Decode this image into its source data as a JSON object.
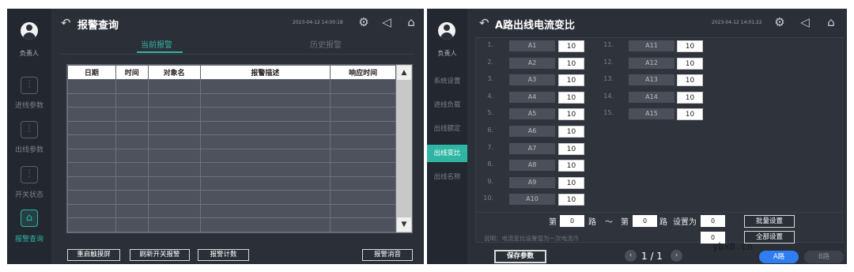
{
  "left": {
    "user_label": "负责人",
    "nav": [
      "进线参数",
      "出线参数",
      "开关状态",
      "报警查询"
    ],
    "title": "报警查询",
    "datetime": "2023-04-12 14:00:18",
    "tabs": [
      "当前报警",
      "历史报警"
    ],
    "table_headers": [
      "日期",
      "时间",
      "对象名",
      "报警描述",
      "响应时间"
    ],
    "buttons": [
      "重启触摸屏",
      "刷新开关报警",
      "报警计数",
      "报警消音"
    ]
  },
  "right": {
    "user_label": "负责人",
    "nav": [
      "系统设置",
      "进线负载",
      "出线额定",
      "出线变比",
      "出线名称"
    ],
    "title": "A路出线电流变比",
    "datetime": "2023-04-12 14:01:22",
    "rows_left": [
      {
        "num": "1.",
        "label": "A1",
        "value": "10"
      },
      {
        "num": "2.",
        "label": "A2",
        "value": "10"
      },
      {
        "num": "3.",
        "label": "A3",
        "value": "10"
      },
      {
        "num": "4.",
        "label": "A4",
        "value": "10"
      },
      {
        "num": "5.",
        "label": "A5",
        "value": "10"
      },
      {
        "num": "6.",
        "label": "A6",
        "value": "10"
      },
      {
        "num": "7.",
        "label": "A7",
        "value": "10"
      },
      {
        "num": "8.",
        "label": "A8",
        "value": "10"
      },
      {
        "num": "9.",
        "label": "A9",
        "value": "10"
      },
      {
        "num": "10.",
        "label": "A10",
        "value": "10"
      }
    ],
    "rows_right": [
      {
        "num": "11.",
        "label": "A11",
        "value": "10"
      },
      {
        "num": "12.",
        "label": "A12",
        "value": "10"
      },
      {
        "num": "13.",
        "label": "A13",
        "value": "10"
      },
      {
        "num": "14.",
        "label": "A14",
        "value": "10"
      },
      {
        "num": "15.",
        "label": "A15",
        "value": "10"
      }
    ],
    "batch": {
      "di": "第",
      "lu": "路",
      "tilde": "～",
      "set_to": "设置为",
      "from": "0",
      "to": "0",
      "value": "0",
      "all_value": "0",
      "batch_button": "批量设置",
      "all_button": "全部设置"
    },
    "note": "说明：电流变比设置值为一次电流/5",
    "save_button": "保存参数",
    "page": "1 / 1",
    "route_a": "A路",
    "route_b": "B路"
  },
  "watermark": "ybx8.cn"
}
